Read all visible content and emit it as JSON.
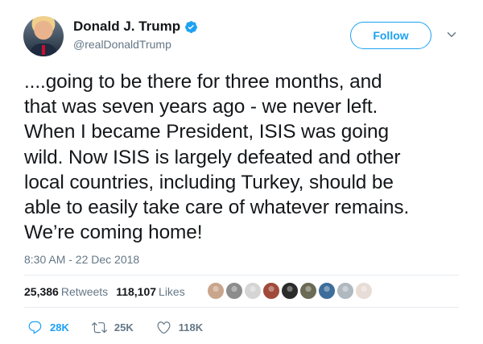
{
  "user": {
    "name": "Donald J. Trump",
    "handle": "@realDonaldTrump"
  },
  "follow_label": "Follow",
  "tweet": {
    "lines": [
      "....going to be there for three months, and",
      "that was seven years ago - we never left.",
      "When I became President, ISIS was going",
      "wild. Now ISIS is largely defeated and other",
      "local countries, including Turkey, should be",
      "able to easily take care of whatever remains.",
      "We’re coming home!"
    ],
    "timestamp": "8:30 AM - 22 Dec 2018"
  },
  "stats": {
    "retweets_count": "25,386",
    "retweets_label": "Retweets",
    "likes_count": "118,107",
    "likes_label": "Likes"
  },
  "liker_avatar_colors": [
    "#c9a58c",
    "#8c8c8c",
    "#d5d5d5",
    "#a04a3a",
    "#2b2b2b",
    "#6b6b55",
    "#3d6d9a",
    "#b0b8c0",
    "#e7dcd6"
  ],
  "actions": {
    "reply_count": "28K",
    "retweet_count": "25K",
    "like_count": "118K"
  },
  "colors": {
    "accent": "#1da1f2",
    "secondary_text": "#657786"
  }
}
